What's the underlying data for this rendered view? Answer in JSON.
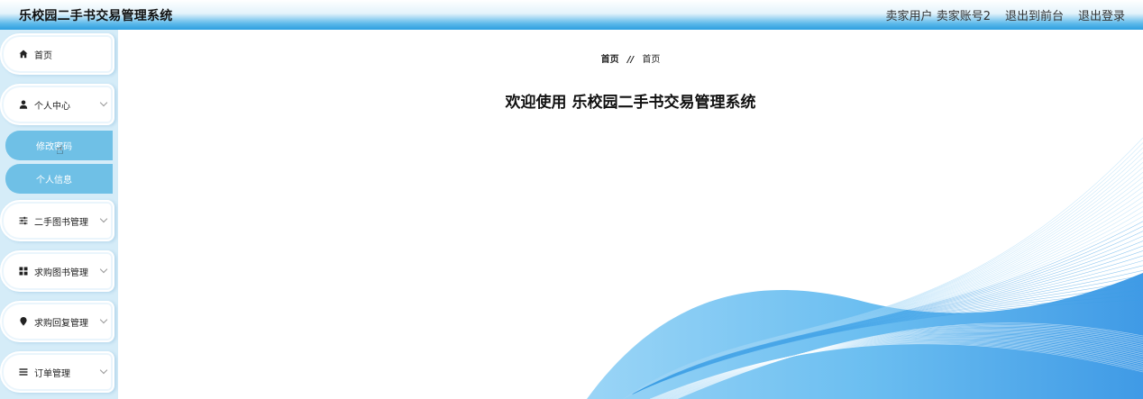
{
  "header": {
    "app_title": "乐校园二手书交易管理系统",
    "user_role": "卖家用户",
    "username": "卖家账号2",
    "back_to_front": "退出到前台",
    "logout": "退出登录"
  },
  "sidebar": {
    "items": [
      {
        "label": "首页",
        "icon": "home-icon",
        "expandable": false
      },
      {
        "label": "个人中心",
        "icon": "user-icon",
        "expandable": true,
        "expanded": true,
        "children": [
          {
            "label": "修改密码"
          },
          {
            "label": "个人信息"
          }
        ]
      },
      {
        "label": "二手图书管理",
        "icon": "sliders-icon",
        "expandable": true
      },
      {
        "label": "求购图书管理",
        "icon": "grid-icon",
        "expandable": true
      },
      {
        "label": "求购回复管理",
        "icon": "location-pin-icon",
        "expandable": true
      },
      {
        "label": "订单管理",
        "icon": "list-icon",
        "expandable": true
      }
    ]
  },
  "main": {
    "breadcrumb": {
      "root": "首页",
      "separator": "//",
      "current": "首页"
    },
    "welcome_text": "欢迎使用 乐校园二手书交易管理系统"
  },
  "colors": {
    "accent": "#2d9fdf",
    "submenu": "#6fc0e6",
    "sidebar_bg": "#d5ecf8"
  }
}
